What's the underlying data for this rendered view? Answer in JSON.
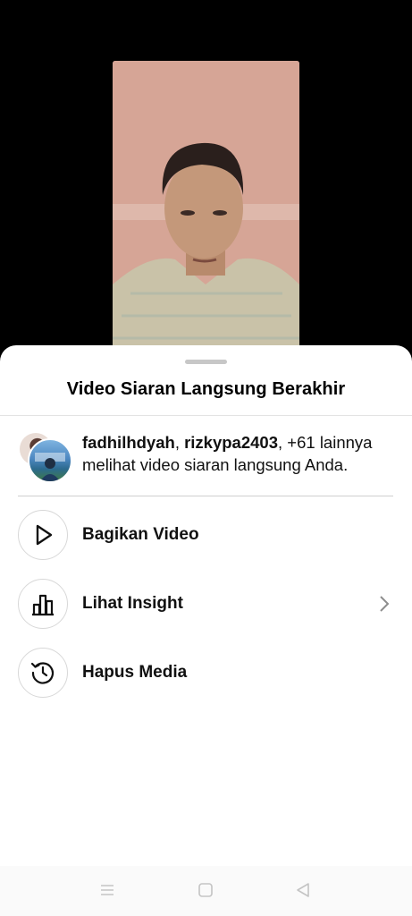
{
  "sheet": {
    "title": "Video Siaran Langsung Berakhir"
  },
  "viewers": {
    "name1": "fadhilhdyah",
    "separator": ", ",
    "name2": "rizkypa2403",
    "rest": ", +61 lainnya melihat video siaran langsung Anda."
  },
  "actions": [
    {
      "label": "Bagikan Video",
      "icon": "play-icon"
    },
    {
      "label": "Lihat Insight",
      "icon": "bar-chart-icon"
    },
    {
      "label": "Hapus Media",
      "icon": "history-icon"
    }
  ],
  "nav": {
    "icons": [
      "menu-icon",
      "home-square-icon",
      "back-triangle-icon"
    ]
  }
}
